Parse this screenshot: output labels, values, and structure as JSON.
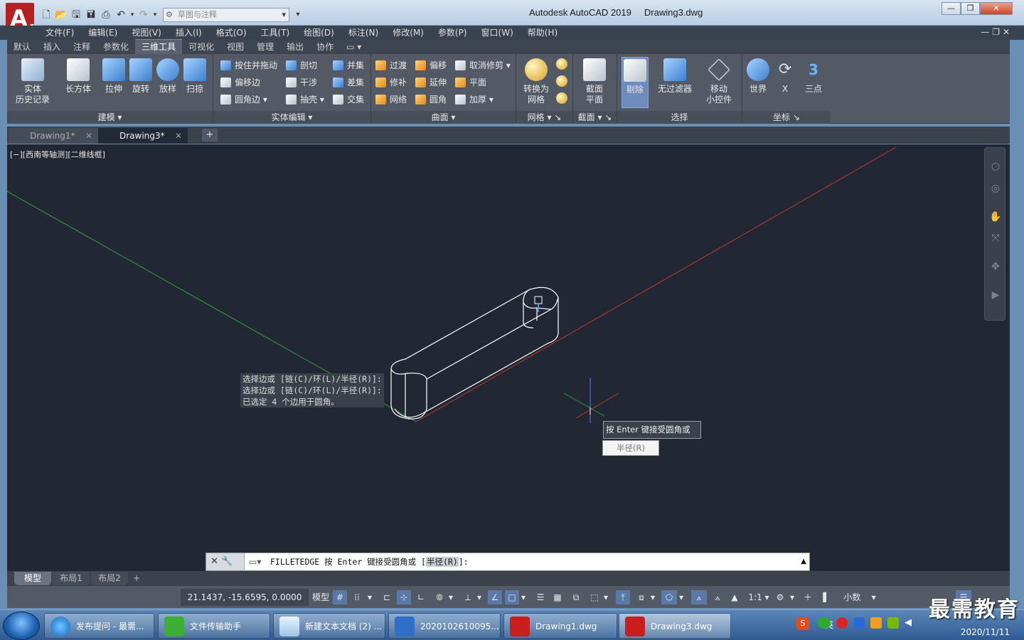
{
  "window": {
    "app_title": "Autodesk AutoCAD 2019",
    "document_title": "Drawing3.dwg",
    "workspace_placeholder": "草图与注释",
    "minimize": "—",
    "restore": "❐",
    "close": "✕"
  },
  "menubar": {
    "items": [
      "文件(F)",
      "编辑(E)",
      "视图(V)",
      "插入(I)",
      "格式(O)",
      "工具(T)",
      "绘图(D)",
      "标注(N)",
      "修改(M)",
      "参数(P)",
      "窗口(W)",
      "帮助(H)"
    ]
  },
  "ribbon_tabs": [
    "默认",
    "插入",
    "注释",
    "参数化",
    "三维工具",
    "可视化",
    "视图",
    "管理",
    "输出",
    "协作"
  ],
  "ribbon": {
    "modeling": {
      "title": "建模",
      "buttons": [
        "实体\n历史记录",
        "长方体",
        "拉伸",
        "旋转",
        "放样",
        "扫掠"
      ]
    },
    "solid_edit": {
      "title": "实体编辑",
      "buttons": [
        "按住并拖动",
        "偏移边",
        "圆角边",
        "剖切",
        "干涉",
        "抽壳",
        "并集",
        "差集",
        "交集"
      ]
    },
    "surface": {
      "title": "曲面",
      "buttons": [
        "过渡",
        "修补",
        "网络",
        "偏移",
        "延伸",
        "圆角",
        "取消修剪",
        "平面",
        "加厚"
      ]
    },
    "mesh": {
      "title": "网格",
      "buttons": [
        "转换为\n网格"
      ]
    },
    "section": {
      "title": "截面",
      "buttons": [
        "截面\n平面"
      ]
    },
    "selection": {
      "title": "选择",
      "buttons": [
        "剔除",
        "无过滤器",
        "移动\n小控件"
      ]
    },
    "coordinates": {
      "title": "坐标",
      "buttons": [
        "世界",
        "X",
        "三点"
      ]
    }
  },
  "doc_tabs": [
    {
      "label": "Drawing1*",
      "active": false
    },
    {
      "label": "Drawing3*",
      "active": true
    }
  ],
  "viewport": {
    "label": "[−][西南等轴测][二维线框]",
    "tooltip": "按 Enter 键接受圆角或",
    "tooltip_option": "半径(R)"
  },
  "command": {
    "history": [
      "选择边或 [链(C)/环(L)/半径(R)]:",
      "选择边或 [链(C)/环(L)/半径(R)]:",
      "已选定 4 个边用于圆角。"
    ],
    "prompt_cmd": "FILLETEDGE",
    "prompt_text": " 按 Enter 键接受圆角或 [",
    "prompt_option": "半径(R)",
    "prompt_end": "]:"
  },
  "layout_tabs": [
    {
      "label": "模型",
      "active": true
    },
    {
      "label": "布局1",
      "active": false
    },
    {
      "label": "布局2",
      "active": false
    }
  ],
  "status": {
    "coords": "21.1437, -15.6595, 0.0000",
    "model": "模型",
    "scale": "1:1",
    "units": "小数"
  },
  "taskbar": {
    "items": [
      {
        "label": "发布提问 - 最需...",
        "icon": "ie-icon"
      },
      {
        "label": "文件传输助手",
        "icon": "wechat-icon"
      },
      {
        "label": "新建文本文档 (2) ...",
        "icon": "notepad-icon"
      },
      {
        "label": "2020102610095...",
        "icon": "video-icon"
      },
      {
        "label": "Drawing1.dwg",
        "icon": "autocad-icon"
      },
      {
        "label": "Drawing3.dwg",
        "icon": "autocad-icon"
      }
    ],
    "ime": "英",
    "date": "2020/11/11"
  },
  "watermark": "最需教育",
  "colors": {
    "viewport_bg": "#212834",
    "accent": "#5a79a8",
    "x_axis": "#c0392b",
    "y_axis": "#2e9b3a"
  }
}
